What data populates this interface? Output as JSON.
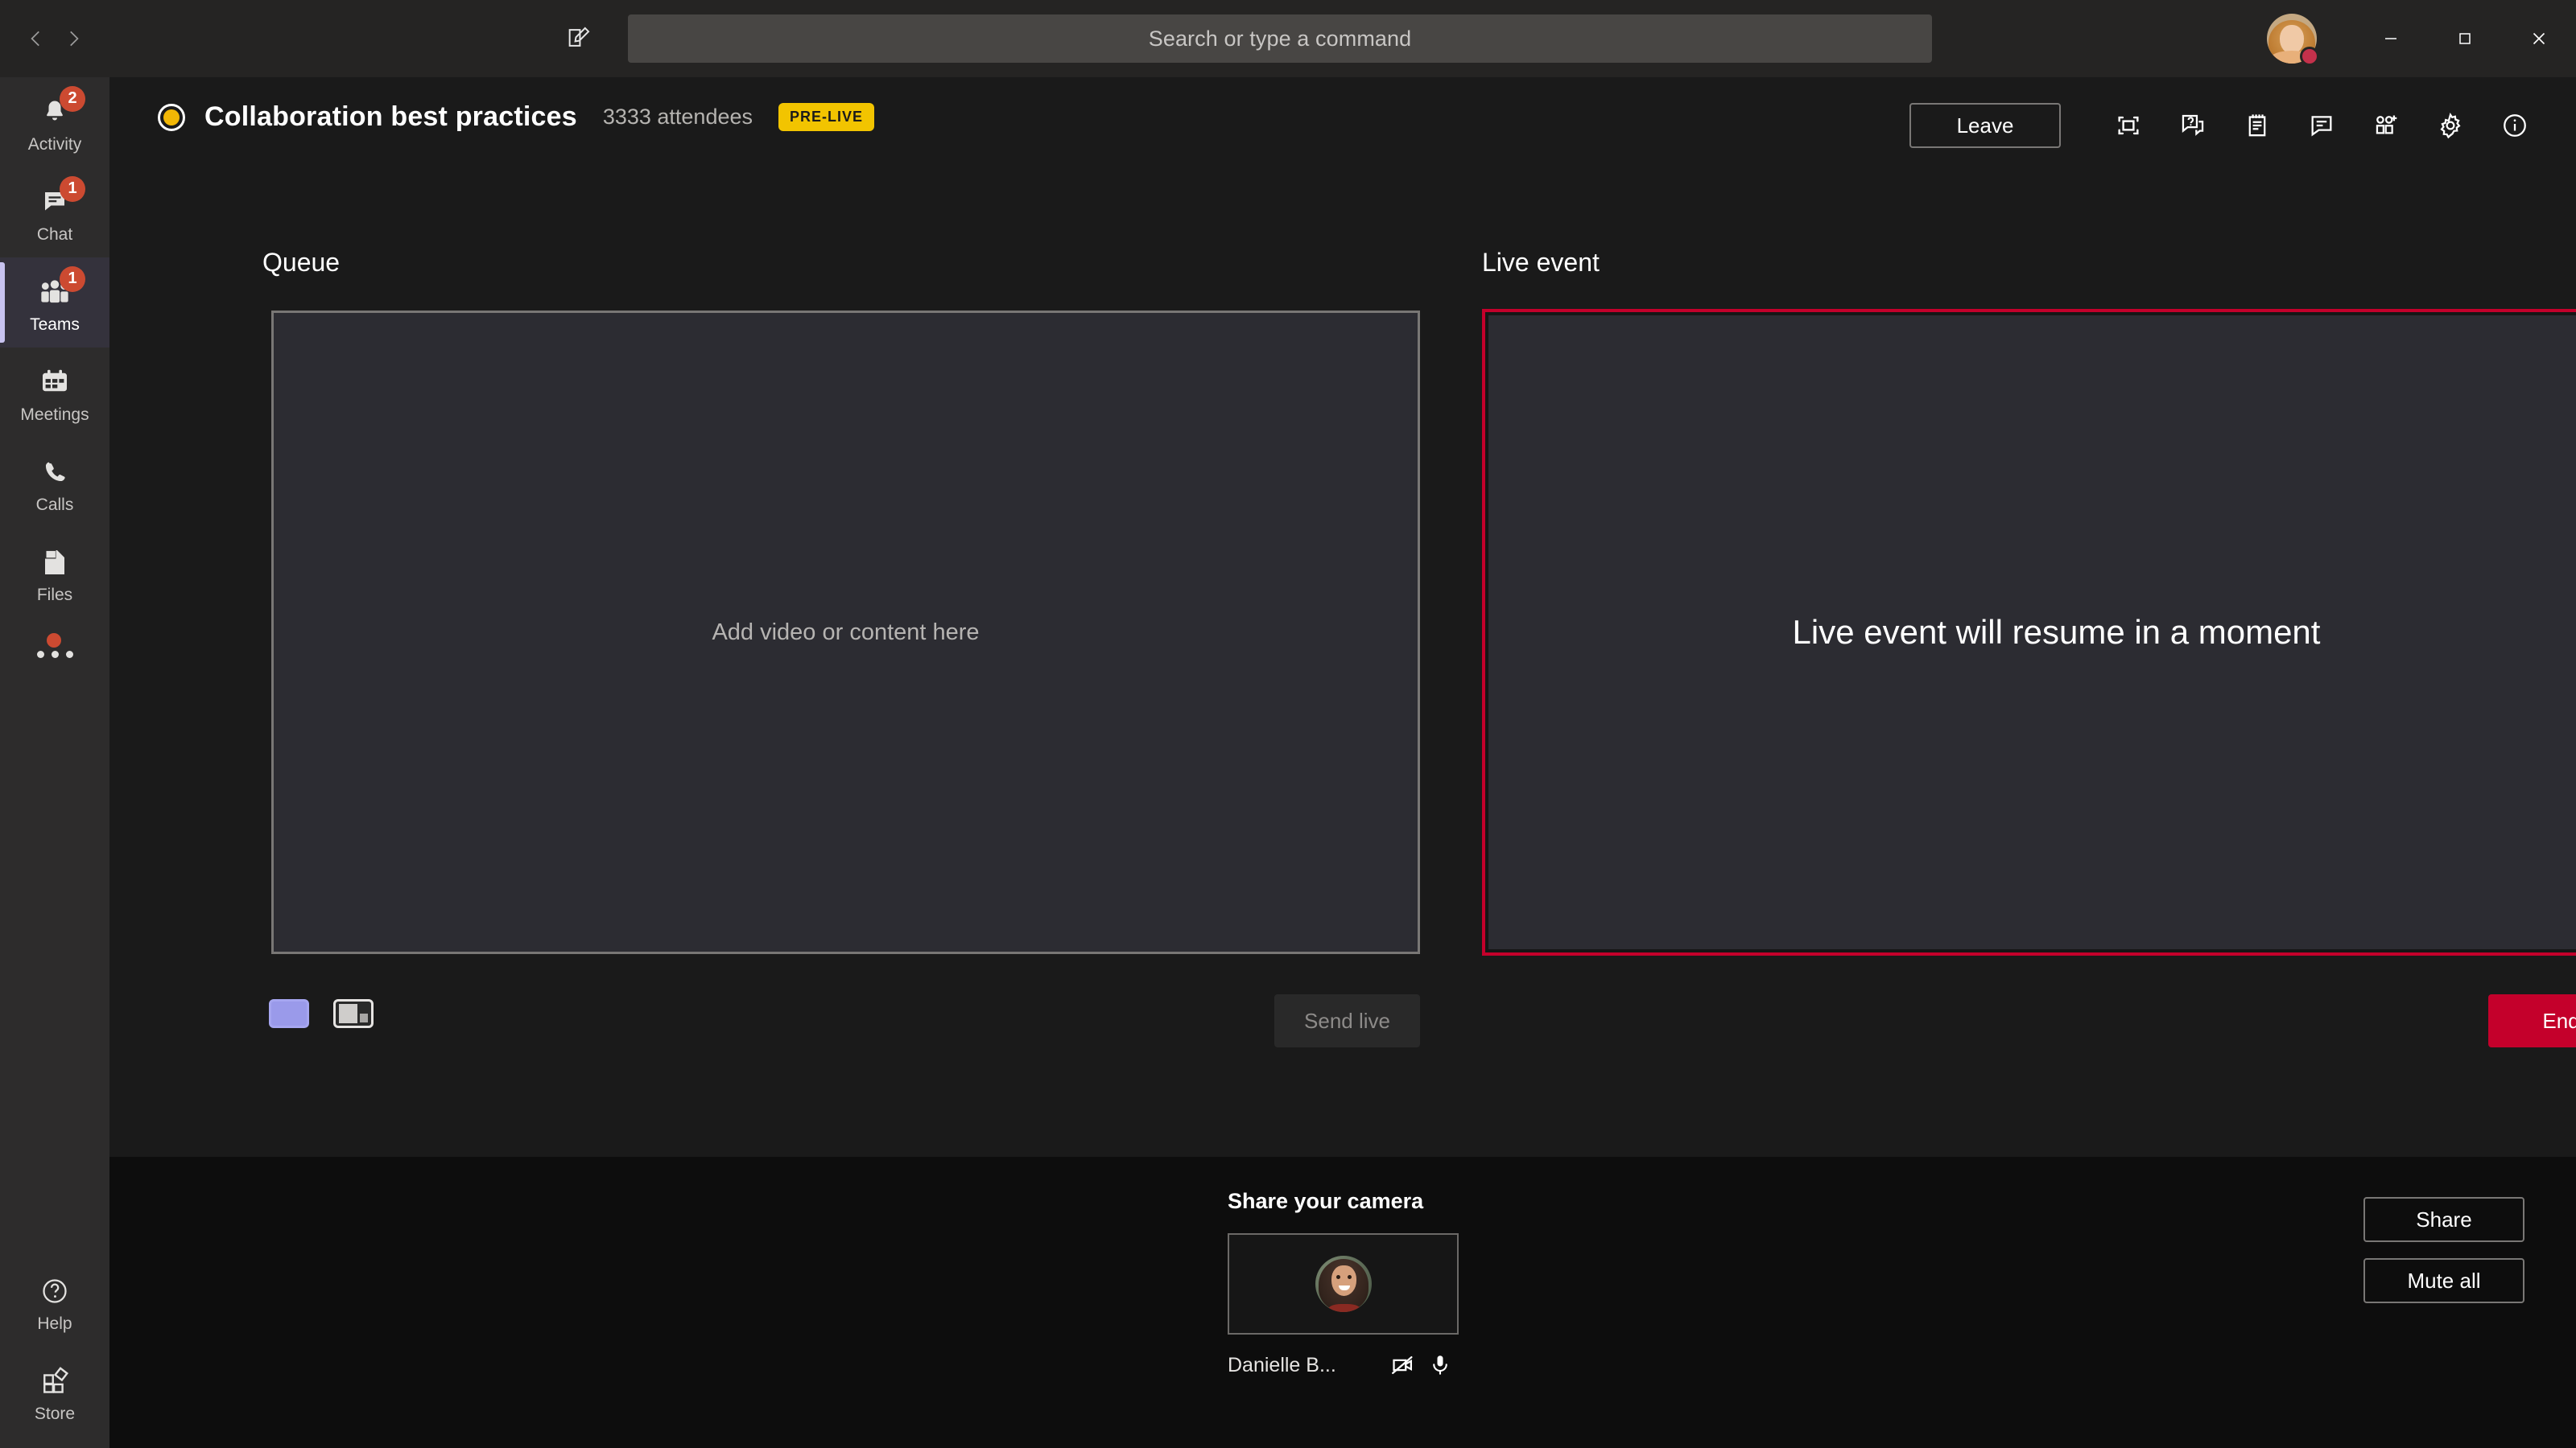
{
  "titlebar": {
    "back_icon": "chevron-left-icon",
    "forward_icon": "chevron-right-icon",
    "compose_icon": "compose-pencil-icon",
    "search_placeholder": "Search or type a command",
    "minimize_label": "minimize-icon",
    "maximize_label": "maximize-icon",
    "close_label": "close-icon",
    "presence": "busy"
  },
  "rail": {
    "items": [
      {
        "label": "Activity",
        "icon": "bell-icon",
        "badge": "2",
        "active": false
      },
      {
        "label": "Chat",
        "icon": "chat-bubble-icon",
        "badge": "1",
        "active": false
      },
      {
        "label": "Teams",
        "icon": "people-icon",
        "badge": "1",
        "active": true
      },
      {
        "label": "Meetings",
        "icon": "calendar-icon",
        "badge": "",
        "active": false
      },
      {
        "label": "Calls",
        "icon": "phone-icon",
        "badge": "",
        "active": false
      },
      {
        "label": "Files",
        "icon": "files-icon",
        "badge": "",
        "active": false
      }
    ],
    "more_icon": "more-dots-icon",
    "bottom": [
      {
        "label": "Help",
        "icon": "help-circle-icon"
      },
      {
        "label": "Store",
        "icon": "store-grid-icon"
      }
    ]
  },
  "event": {
    "status_icon": "recording-status-icon",
    "status_color": "#f2b705",
    "title": "Collaboration best practices",
    "attendees": "3333 attendees",
    "state_badge": "PRE-LIVE",
    "state_badge_color": "#f2c400",
    "leave_label": "Leave",
    "tools": [
      {
        "name": "fullscreen-icon",
        "label": "Full screen"
      },
      {
        "name": "qna-icon",
        "label": "Q&A"
      },
      {
        "name": "notes-icon",
        "label": "Meeting notes"
      },
      {
        "name": "chat-icon",
        "label": "Chat"
      },
      {
        "name": "add-people-icon",
        "label": "Add participants"
      },
      {
        "name": "settings-gear-icon",
        "label": "Device settings"
      },
      {
        "name": "info-icon",
        "label": "Event info"
      }
    ]
  },
  "queue": {
    "label": "Queue",
    "placeholder": "Add video or content here",
    "layouts": [
      {
        "name": "layout-single",
        "selected": true
      },
      {
        "name": "layout-content-plus-presenter",
        "selected": false
      }
    ],
    "send_live_label": "Send live",
    "send_live_disabled": true
  },
  "live": {
    "label": "Live event",
    "message": "Live event will resume in a moment",
    "border_color": "#c4002b",
    "end_label": "End"
  },
  "bottom": {
    "share_camera_title": "Share your camera",
    "presenter_name": "Danielle B...",
    "camera_icon": "camera-off-icon",
    "mic_icon": "microphone-icon",
    "share_label": "Share",
    "mute_all_label": "Mute all"
  }
}
